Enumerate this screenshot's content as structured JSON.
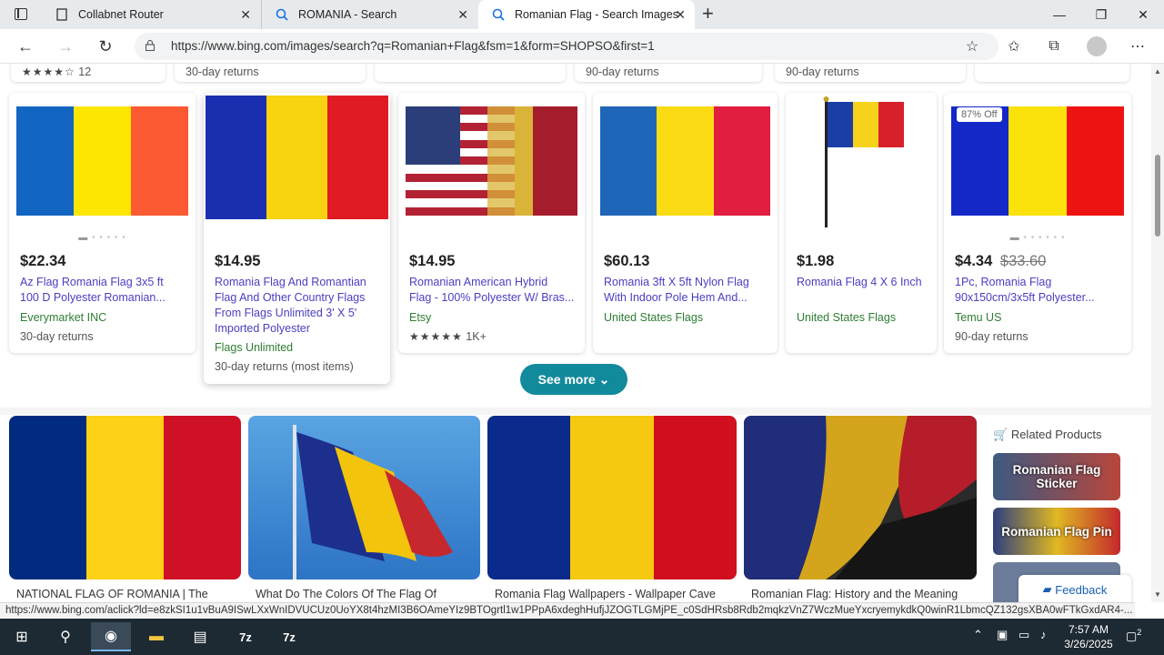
{
  "browser": {
    "tabs": [
      {
        "label": "Collabnet Router",
        "icon": "page-icon"
      },
      {
        "label": "ROMANIA - Search",
        "icon": "search-icon"
      },
      {
        "label": "Romanian Flag - Search Images",
        "icon": "search-icon",
        "active": true
      }
    ],
    "url": "https://www.bing.com/images/search?q=Romanian+Flag&fsm=1&form=SHOPSO&first=1"
  },
  "previous_row": {
    "card1": "12",
    "card2": "30-day returns",
    "card4": "90-day returns",
    "card5": "90-day returns"
  },
  "products": [
    {
      "price": "$22.34",
      "old_price": "",
      "title_lines": [
        "Az Flag Romania Flag 3x5 ft",
        "100 D Polyester Romanian..."
      ],
      "seller": "Everymarket INC",
      "returns": "30-day returns",
      "badge": ""
    },
    {
      "price": "$14.95",
      "old_price": "",
      "title_lines": [
        "Romania Flag And Romantian",
        "Flag And Other Country Flags",
        "From Flags Unlimited 3' X 5'",
        "Imported Polyester"
      ],
      "seller": "Flags Unlimited",
      "returns": "30-day returns (most items)",
      "badge": ""
    },
    {
      "price": "$14.95",
      "old_price": "",
      "title_lines": [
        "Romanian American Hybrid",
        "Flag - 100% Polyester W/ Bras..."
      ],
      "seller": "Etsy",
      "rating_count": "1K+",
      "badge": ""
    },
    {
      "price": "$60.13",
      "old_price": "",
      "title_lines": [
        "Romania 3ft X 5ft Nylon Flag",
        "With Indoor Pole Hem And..."
      ],
      "seller": "United States Flags",
      "badge": ""
    },
    {
      "price": "$1.98",
      "old_price": "",
      "title_lines": [
        "Romania Flag 4 X 6 Inch"
      ],
      "seller": "United States Flags",
      "badge": ""
    },
    {
      "price": "$4.34",
      "old_price": "$33.60",
      "title_lines": [
        "1Pc, Romania Flag",
        "90x150cm/3x5ft Polyester..."
      ],
      "seller": "Temu US",
      "returns": "90-day returns",
      "badge": "87% Off"
    }
  ],
  "see_more": "See more",
  "image_results": [
    {
      "caption": "NATIONAL FLAG OF ROMANIA | The"
    },
    {
      "caption": "What Do The Colors Of The Flag Of"
    },
    {
      "caption": "Romania Flag Wallpapers - Wallpaper Cave"
    },
    {
      "caption": "Romanian Flag: History and the Meaning"
    }
  ],
  "related": {
    "heading": "Related Products",
    "items": [
      "Romanian Flag Sticker",
      "Romanian Flag Pin"
    ]
  },
  "feedback": "Feedback",
  "status_url": "https://www.bing.com/aclick?ld=e8zkSI1u1vBuA9ISwLXxWnIDVUCUz0UoYX8t4hzMI3B6OAmeYIz9BTOgrtl1w1PPpA6xdeghHufjJZOGTLGMjPE_c0SdHRsb8Rdb2mqkzVnZ7WczMueYxcryemykdkQ0winR1LbmcQZ132gsXBA0wFTkGxdAR4-...",
  "taskbar": {
    "time": "7:57 AM",
    "date": "3/26/2025",
    "notifications": "2"
  },
  "colors": {
    "romania_blue": "#1265c0",
    "romania_yellow": "#fde600",
    "romania_red": "#e8242b",
    "accent": "#118a9c"
  }
}
